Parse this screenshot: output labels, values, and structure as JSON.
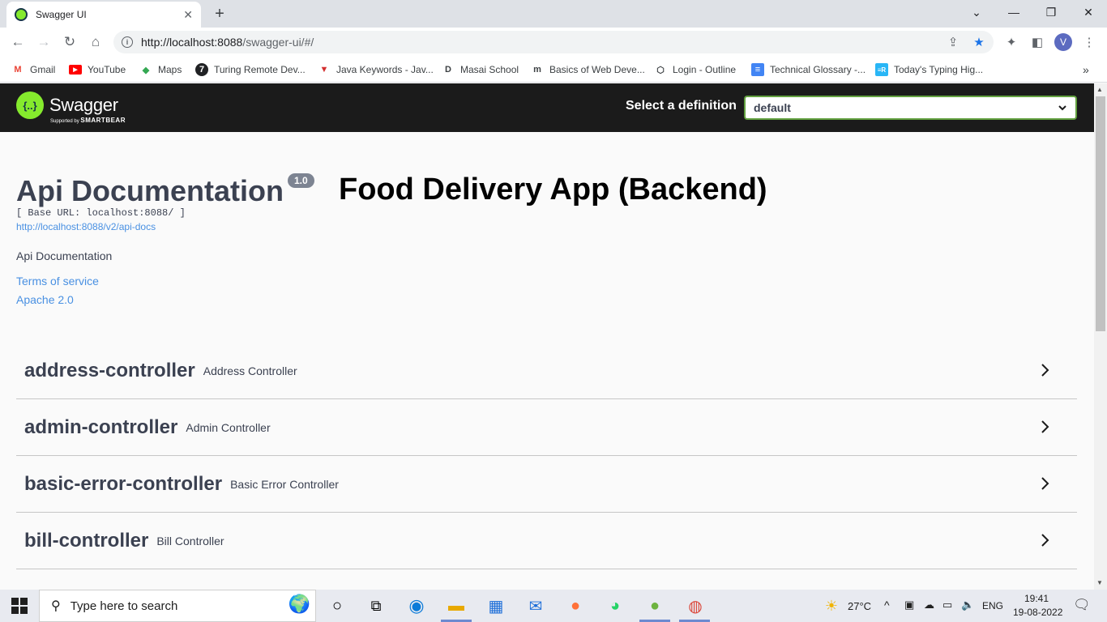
{
  "browser": {
    "tab_title": "Swagger UI",
    "url_host": "http://localhost:8088",
    "url_path": "/swagger-ui/#/",
    "profile_initial": "V",
    "bookmarks": [
      {
        "label": "Gmail",
        "icon": "gmail-icon",
        "glyph": "M",
        "color": "#ea4335"
      },
      {
        "label": "YouTube",
        "icon": "youtube-icon",
        "glyph": "▶",
        "color": "#ff0000"
      },
      {
        "label": "Maps",
        "icon": "maps-icon",
        "glyph": "◆",
        "color": "#34a853"
      },
      {
        "label": "Turing Remote Dev...",
        "icon": "turing-icon",
        "glyph": "7",
        "color": "#202124"
      },
      {
        "label": "Java Keywords - Jav...",
        "icon": "java-keywords-icon",
        "glyph": "▼",
        "color": "#d32f2f"
      },
      {
        "label": "Masai School",
        "icon": "masai-icon",
        "glyph": "D",
        "color": "#202124"
      },
      {
        "label": "Basics of Web Deve...",
        "icon": "medium-icon",
        "glyph": "m",
        "color": "#202124"
      },
      {
        "label": "Login - Outline",
        "icon": "outline-icon",
        "glyph": "⬡",
        "color": "#202124"
      },
      {
        "label": "Technical Glossary -...",
        "icon": "docs-icon",
        "glyph": "≡",
        "color": "#4285f4"
      },
      {
        "label": "Today's Typing Hig...",
        "icon": "typing-icon",
        "glyph": "≡R",
        "color": "#29b6f6"
      }
    ]
  },
  "swagger": {
    "brand": "Swagger",
    "brand_sub": "Supported by",
    "brand_sub_strong": "SMARTBEAR",
    "definition_label": "Select a definition",
    "definition_value": "default",
    "api_title": "Api Documentation",
    "version": "1.0",
    "app_title": "Food Delivery App (Backend)",
    "base_url": "[ Base URL: localhost:8088/ ]",
    "docs_link": "http://localhost:8088/v2/api-docs",
    "description": "Api Documentation",
    "terms": "Terms of service",
    "license": "Apache 2.0",
    "controllers": [
      {
        "name": "address-controller",
        "description": "Address Controller"
      },
      {
        "name": "admin-controller",
        "description": "Admin Controller"
      },
      {
        "name": "basic-error-controller",
        "description": "Basic Error Controller"
      },
      {
        "name": "bill-controller",
        "description": "Bill Controller"
      }
    ]
  },
  "taskbar": {
    "search_placeholder": "Type here to search",
    "weather": "27°C",
    "language": "ENG",
    "time": "19:41",
    "date": "19-08-2022"
  }
}
